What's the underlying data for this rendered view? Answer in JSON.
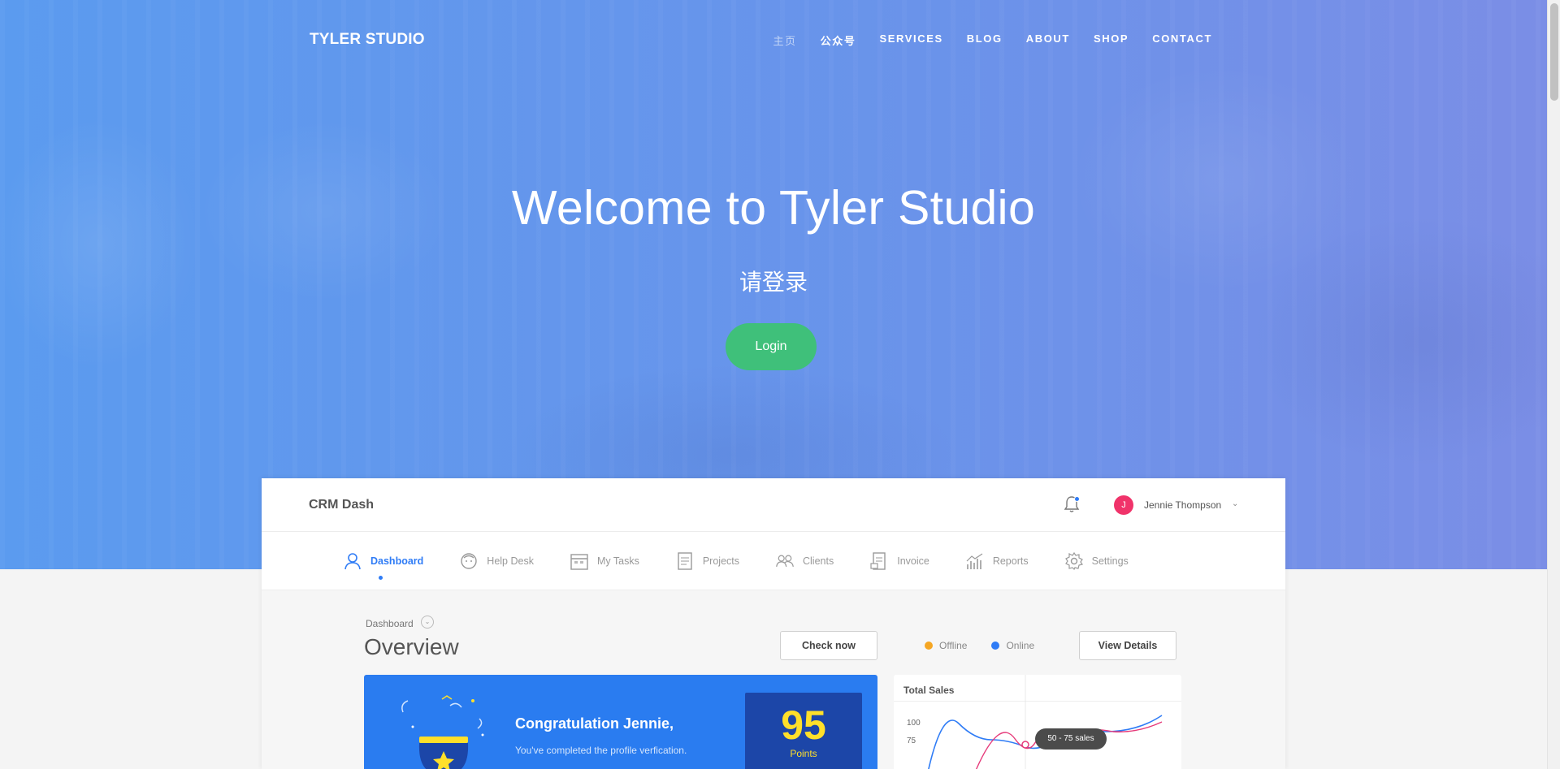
{
  "brand": "TYLER STUDIO",
  "nav": [
    {
      "label": "主页",
      "muted": true
    },
    {
      "label": "公众号",
      "muted": false
    },
    {
      "label": "SERVICES",
      "muted": false
    },
    {
      "label": "BLOG",
      "muted": false
    },
    {
      "label": "ABOUT",
      "muted": false
    },
    {
      "label": "SHOP",
      "muted": false
    },
    {
      "label": "CONTACT",
      "muted": false
    }
  ],
  "hero": {
    "title": "Welcome to Tyler Studio",
    "subtitle": "请登录",
    "login_label": "Login"
  },
  "dashboard": {
    "app_title": "CRM Dash",
    "user": {
      "initial": "J",
      "name": "Jennie Thompson"
    },
    "tabs": [
      {
        "label": "Dashboard",
        "icon": "user-icon",
        "active": true
      },
      {
        "label": "Help Desk",
        "icon": "face-icon",
        "active": false
      },
      {
        "label": "My Tasks",
        "icon": "calendar-icon",
        "active": false
      },
      {
        "label": "Projects",
        "icon": "document-icon",
        "active": false
      },
      {
        "label": "Clients",
        "icon": "users-icon",
        "active": false
      },
      {
        "label": "Invoice",
        "icon": "invoice-icon",
        "active": false
      },
      {
        "label": "Reports",
        "icon": "chart-icon",
        "active": false
      },
      {
        "label": "Settings",
        "icon": "gear-icon",
        "active": false
      }
    ],
    "breadcrumb": "Dashboard",
    "heading": "Overview",
    "check_now": "Check now",
    "legend": [
      {
        "label": "Offline",
        "color": "#f5a623"
      },
      {
        "label": "Online",
        "color": "#2f7cf6"
      }
    ],
    "view_details": "View Details",
    "congrats": {
      "title": "Congratulation Jennie,",
      "subtitle": "You've completed the profile verfication.",
      "points_value": "95",
      "points_label": "Points"
    },
    "sales": {
      "title": "Total Sales",
      "tick_100": "100",
      "tick_75": "75",
      "tooltip": "50 - 75 sales"
    }
  },
  "colors": {
    "hero_start": "#5b9bef",
    "hero_end": "#7b8ee6",
    "login_green": "#3fc07a",
    "accent_blue": "#2f7cf6",
    "congrats_blue": "#2a7cf0",
    "points_navy": "#1c46a8",
    "points_yellow": "#ffe02a"
  }
}
